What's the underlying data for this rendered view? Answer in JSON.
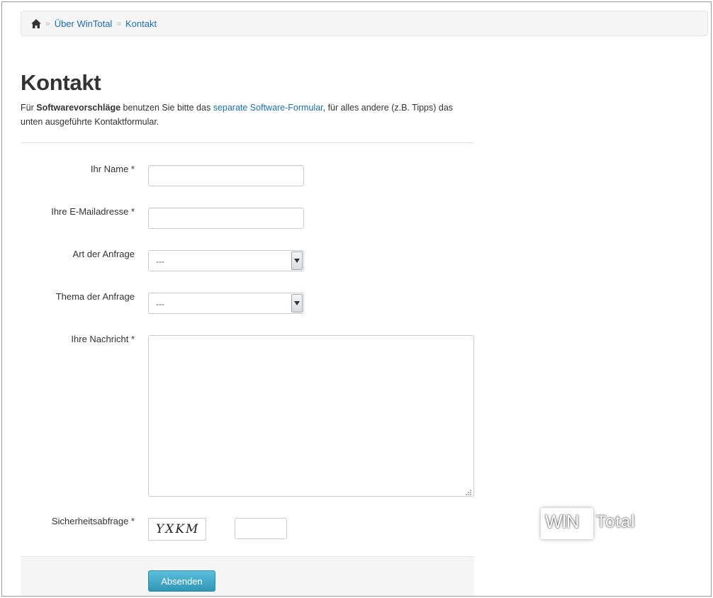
{
  "breadcrumb": {
    "home_icon": "home-icon",
    "items": [
      {
        "label": "Über WinTotal"
      },
      {
        "label": "Kontakt"
      }
    ]
  },
  "page": {
    "title": "Kontakt",
    "intro": {
      "prefix": "Für ",
      "bold": "Softwarevorschläge",
      "middle": " benutzen Sie bitte das ",
      "link": "separate Software-Formular",
      "suffix": ", für alles andere (z.B. Tipps) das unten ausgeführte Kontaktformular."
    }
  },
  "form": {
    "name_label": "Ihr Name *",
    "name_value": "",
    "email_label": "Ihre E-Mailadresse *",
    "email_value": "",
    "type_label": "Art der Anfrage",
    "type_value": "---",
    "topic_label": "Thema der Anfrage",
    "topic_value": "---",
    "message_label": "Ihre Nachricht *",
    "message_value": "",
    "captcha_label": "Sicherheitsabfrage *",
    "captcha_text": "YXKM",
    "captcha_value": "",
    "submit_label": "Absenden"
  },
  "watermark": {
    "part1": "WIN",
    "part2": "Total"
  },
  "colors": {
    "link": "#1a6fb0",
    "button": "#2f96b4",
    "text": "#333333"
  }
}
